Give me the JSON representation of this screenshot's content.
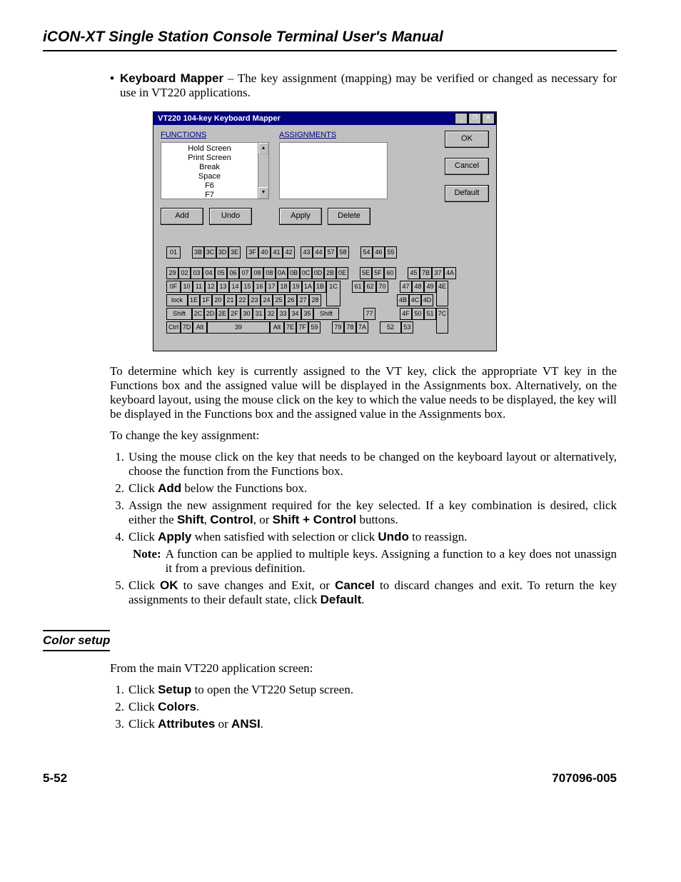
{
  "header": {
    "title": "iCON-XT Single Station Console Terminal User's Manual"
  },
  "bullet": {
    "title": "Keyboard Mapper",
    "text": " – The key assignment (mapping) may be verified or changed as necessary for use in VT220 applications."
  },
  "dialog": {
    "title": "VT220 104-key Keyboard Mapper",
    "min_icon": "_",
    "restore_icon": "❐",
    "close_icon": "✕",
    "functions_label": "FUNCTIONS",
    "assignments_label": "ASSIGNMENTS",
    "list_items": [
      "Hold Screen",
      "Print Screen",
      "Break",
      "Space",
      "F6",
      "F7"
    ],
    "scroll_up": "▴",
    "scroll_down": "▾",
    "buttons": {
      "add": "Add",
      "undo": "Undo",
      "apply": "Apply",
      "delete": "Delete",
      "ok": "OK",
      "cancel": "Cancel",
      "default": "Default"
    },
    "keyboard": {
      "row_fn_a": [
        "01"
      ],
      "row_fn_b": [
        "3B",
        "3C",
        "3D",
        "3E"
      ],
      "row_fn_c": [
        "3F",
        "40",
        "41",
        "42"
      ],
      "row_fn_d": [
        "43",
        "44",
        "57",
        "58"
      ],
      "row_fn_e": [
        "54",
        "46",
        "55"
      ],
      "row1_main": [
        "29",
        "02",
        "03",
        "04",
        "05",
        "06",
        "07",
        "08",
        "08",
        "0A",
        "0B",
        "0C",
        "0D",
        "2B",
        "0E"
      ],
      "row1_nav": [
        "5E",
        "5F",
        "60"
      ],
      "row1_num": [
        "45",
        "7B",
        "37",
        "4A"
      ],
      "row2_main_a": "0F",
      "row2_main": [
        "10",
        "11",
        "12",
        "13",
        "14",
        "15",
        "16",
        "17",
        "18",
        "19",
        "1A",
        "1B"
      ],
      "row2_enter": "1C",
      "row2_nav": [
        "61",
        "62",
        "70"
      ],
      "row2_num": [
        "47",
        "48",
        "49"
      ],
      "row2_num_plus": "4E",
      "row3_main_a": "lock",
      "row3_main": [
        "1E",
        "1F",
        "20",
        "21",
        "22",
        "23",
        "24",
        "25",
        "26",
        "27",
        "28"
      ],
      "row3_num": [
        "4B",
        "4C",
        "4D"
      ],
      "row4_main_a": "Shift",
      "row4_main": [
        "2C",
        "2D",
        "2E",
        "2F",
        "30",
        "31",
        "32",
        "33",
        "34",
        "35"
      ],
      "row4_main_b": "Shift",
      "row4_nav": [
        "77"
      ],
      "row4_num": [
        "4F",
        "50",
        "51"
      ],
      "row4_num_enter": "7C",
      "row5_main": [
        "Ctrl",
        "7D",
        "Alt"
      ],
      "row5_space": "39",
      "row5_right": [
        "Alt",
        "7E",
        "7F",
        "59"
      ],
      "row5_nav": [
        "79",
        "78",
        "7A"
      ],
      "row5_num": [
        "52",
        "53"
      ]
    }
  },
  "para1": "To determine which key is currently assigned to the VT key, click the appropriate VT key in the Functions box and the assigned value will be displayed in the Assignments box.  Alternatively, on the keyboard layout, using the mouse click on the key to which the value needs to be displayed, the key will be displayed in the Functions box and the assigned value in the Assignments box.",
  "para2": "To change the key assignment:",
  "steps": {
    "s1": "Using the mouse click on the key that needs to be changed on the keyboard layout  or alternatively, choose the function from the Functions box.",
    "s2a": "Click ",
    "s2b": "Add",
    "s2c": " below the Functions box.",
    "s3a": "Assign the new assignment required for the key selected.  If a key combination is desired, click either the ",
    "s3b": "Shift",
    "s3c": ", ",
    "s3d": "Control",
    "s3e": ", or ",
    "s3f": "Shift + Control",
    "s3g": " buttons.",
    "s4a": "Click ",
    "s4b": "Apply",
    "s4c": " when satisfied with selection or click ",
    "s4d": "Undo",
    "s4e": " to reassign.",
    "note_label": "Note:",
    "note_text": " A function can be applied to multiple keys. Assigning a function to a key does not unassign it from a previous definition.",
    "s5a": "Click ",
    "s5b": "OK",
    "s5c": " to save changes and Exit, or ",
    "s5d": "Cancel",
    "s5e": " to discard changes and exit.  To return the key assignments to their default state, click ",
    "s5f": "Default",
    "s5g": "."
  },
  "section2": {
    "heading": "Color setup",
    "intro": "From the main VT220 application screen:",
    "c1a": "Click ",
    "c1b": "Setup",
    "c1c": " to open the VT220 Setup screen.",
    "c2a": "Click ",
    "c2b": "Colors",
    "c2c": ".",
    "c3a": "Click ",
    "c3b": "Attributes",
    "c3c": " or ",
    "c3d": "ANSI",
    "c3e": "."
  },
  "footer": {
    "left": "5-52",
    "right": "707096-005"
  }
}
